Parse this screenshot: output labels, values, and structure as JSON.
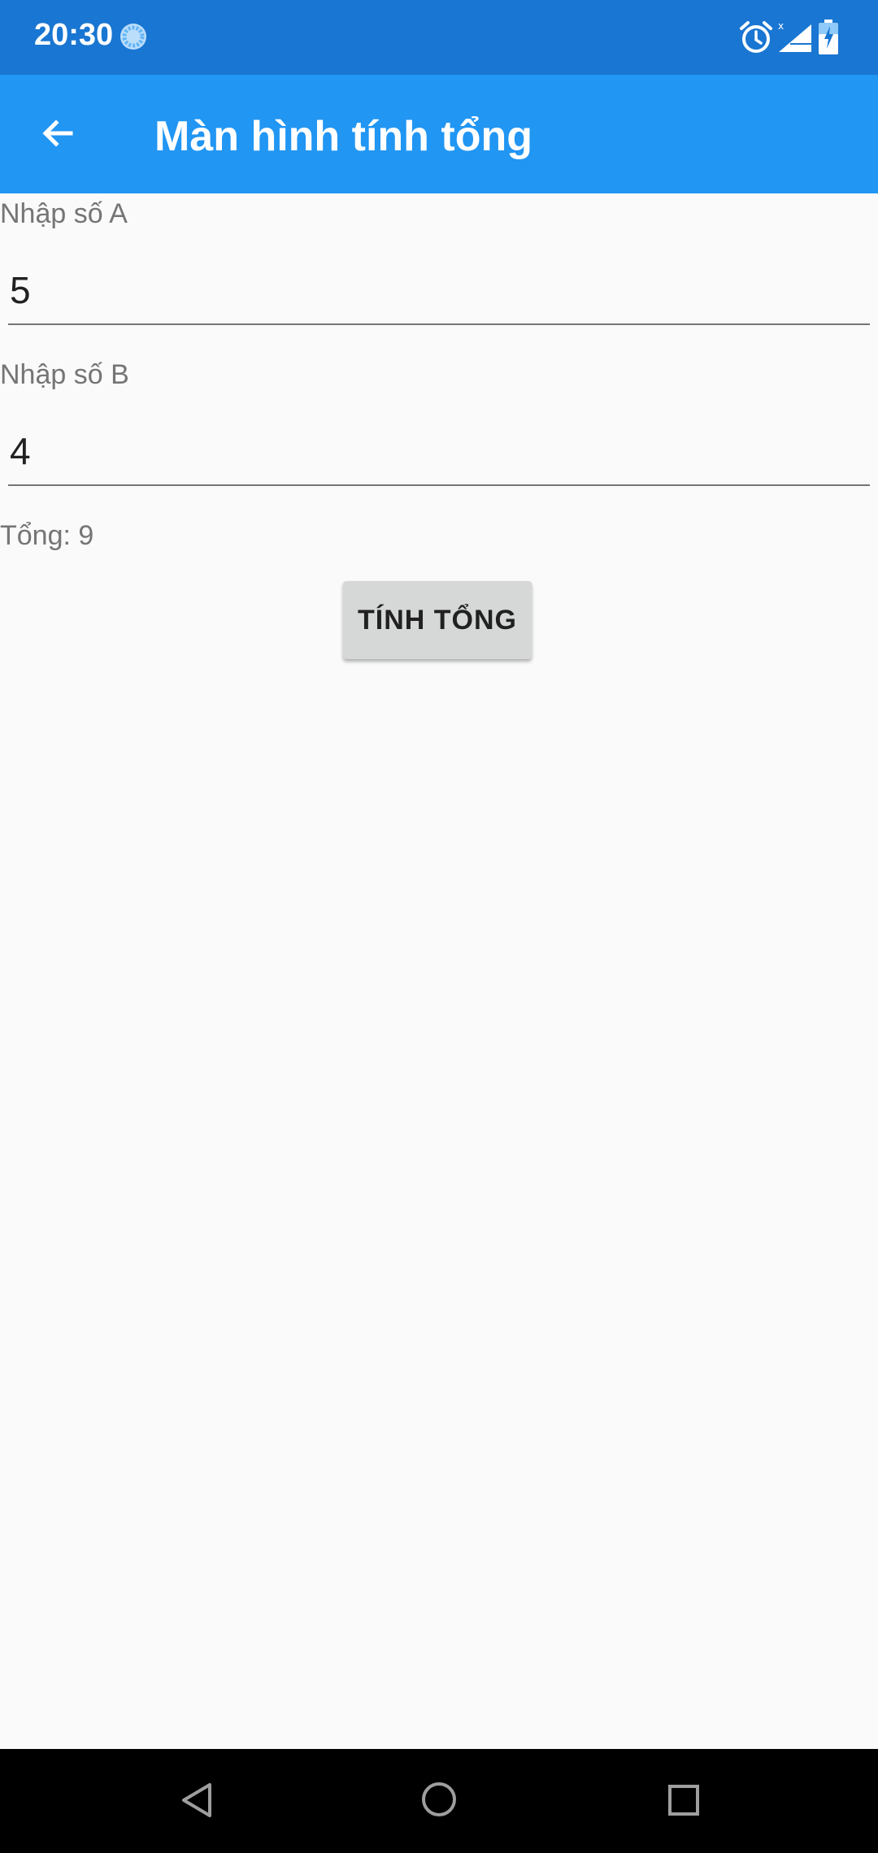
{
  "status_bar": {
    "time": "20:30",
    "icons": [
      "sync-icon",
      "alarm-icon",
      "signal-icon",
      "battery-charging-icon"
    ]
  },
  "app_bar": {
    "back_icon": "arrow-left-icon",
    "title": "Màn hình tính tổng"
  },
  "form": {
    "label_a": "Nhập số A",
    "value_a": "5",
    "label_b": "Nhập số B",
    "value_b": "4",
    "result": "Tổng: 9",
    "button_label": "TÍNH TỔNG"
  },
  "nav_bar": {
    "icons": [
      "nav-back-icon",
      "nav-home-icon",
      "nav-recents-icon"
    ]
  },
  "colors": {
    "status_bar": "#1976d2",
    "app_bar": "#2196f3",
    "background": "#fafafa",
    "button": "#d6d7d7",
    "nav_bar": "#000000"
  }
}
